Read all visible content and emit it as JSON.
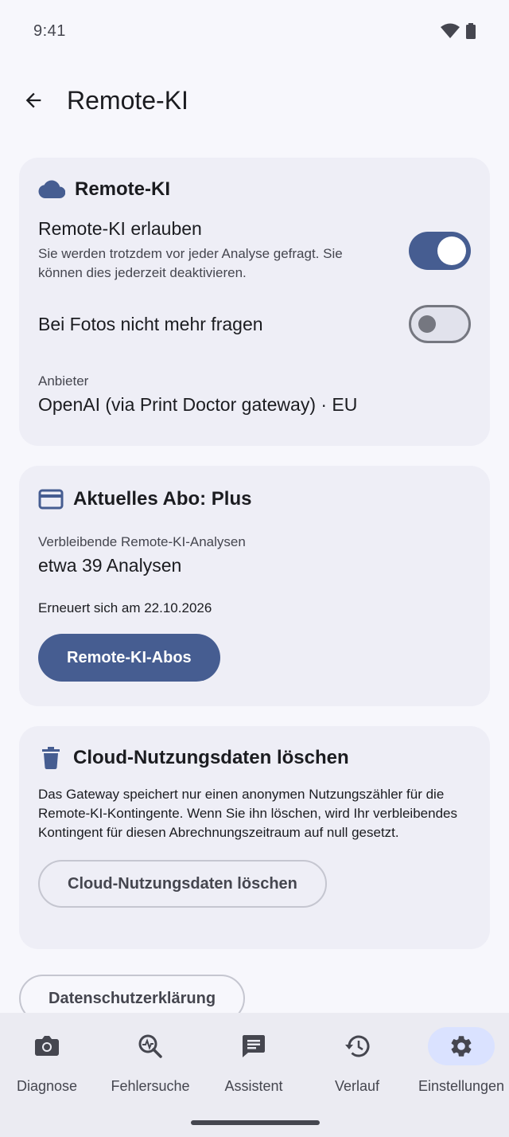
{
  "status_bar": {
    "time": "9:41"
  },
  "top_bar": {
    "title": "Remote-KI"
  },
  "remote_card": {
    "title": "Remote-KI",
    "allow_label": "Remote-KI erlauben",
    "allow_desc": "Sie werden trotzdem vor jeder Analyse gefragt. Sie können dies jederzeit deaktivieren.",
    "allow_enabled": true,
    "photos_label": "Bei Fotos nicht mehr fragen",
    "photos_enabled": false,
    "provider_label": "Anbieter",
    "provider_value": "OpenAI (via Print Doctor gateway) · EU"
  },
  "subscription_card": {
    "title": "Aktuelles Abo: Plus",
    "remaining_label": "Verbleibende Remote-KI-Analysen",
    "remaining_value": "etwa 39 Analysen",
    "renewal_text": "Erneuert sich am 22.10.2026",
    "button_label": "Remote-KI-Abos"
  },
  "cloud_card": {
    "title": "Cloud-Nutzungsdaten löschen",
    "description": "Das Gateway speichert nur einen anonymen Nutzungszähler für die Remote-KI-Kontingente. Wenn Sie ihn löschen, wird Ihr verbleibendes Kontingent für diesen Abrechnungszeitraum auf null gesetzt.",
    "button_label": "Cloud-Nutzungsdaten löschen"
  },
  "privacy_button": "Datenschutzerklärung",
  "bottom_nav": {
    "items": [
      {
        "label": "Diagnose",
        "icon": "camera-icon"
      },
      {
        "label": "Fehlersuche",
        "icon": "search-activity-icon"
      },
      {
        "label": "Assistent",
        "icon": "chat-icon"
      },
      {
        "label": "Verlauf",
        "icon": "history-icon"
      },
      {
        "label": "Einstellungen",
        "icon": "gear-icon",
        "active": true
      }
    ]
  },
  "colors": {
    "primary": "#465d91",
    "surface": "#f7f7fc",
    "card": "#eeeef6",
    "nav_active_pill": "#dae2ff"
  }
}
